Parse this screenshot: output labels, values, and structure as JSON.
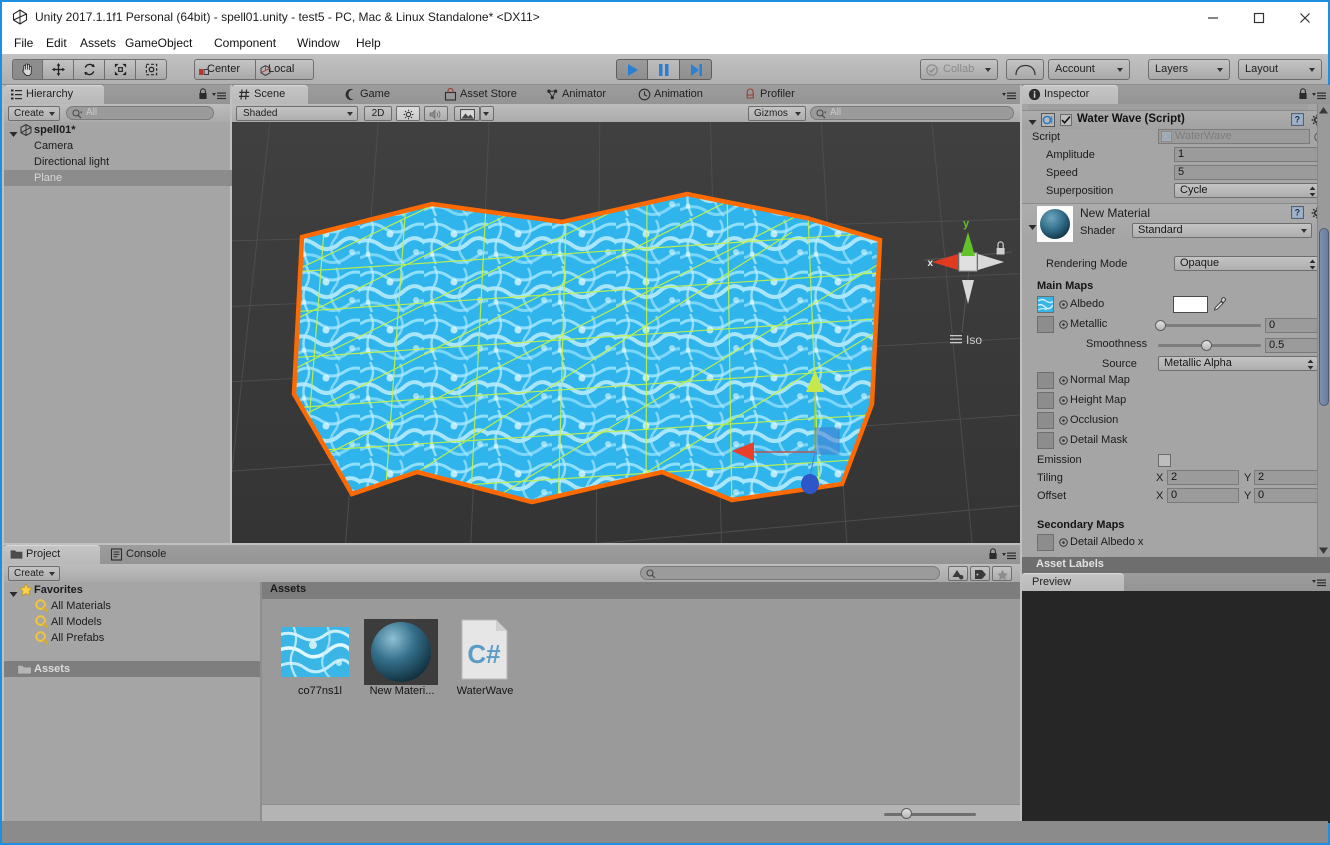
{
  "window": {
    "title": "Unity 2017.1.1f1 Personal (64bit) - spell01.unity - test5 - PC, Mac & Linux Standalone* <DX11>",
    "app_icon": "unity-logo-icon",
    "minimize": "minimize-icon",
    "maximize": "maximize-icon",
    "close": "close-icon"
  },
  "menu": {
    "items": [
      "File",
      "Edit",
      "Assets",
      "GameObject",
      "Component",
      "Window",
      "Help"
    ]
  },
  "toolbar": {
    "transform_tools": [
      {
        "name": "hand-tool",
        "icon": "hand-icon",
        "active": true
      },
      {
        "name": "move-tool",
        "icon": "move-arrows-icon",
        "active": false
      },
      {
        "name": "rotate-tool",
        "icon": "rotate-icon",
        "active": false
      },
      {
        "name": "scale-tool",
        "icon": "scale-icon",
        "active": false
      },
      {
        "name": "rect-tool",
        "icon": "rect-transform-icon",
        "active": false
      }
    ],
    "pivot_mode": "Center",
    "pivot_rotation": "Local",
    "play": "play-icon",
    "pause": "pause-icon",
    "step": "step-icon",
    "collab": "Collab",
    "cloud": "cloud-icon",
    "account": "Account",
    "layers": "Layers",
    "layout": "Layout"
  },
  "hierarchy": {
    "tab": "Hierarchy",
    "tab_icon": "hierarchy-icon",
    "create": "Create",
    "search_placeholder": "All",
    "search_value": "",
    "rows": [
      {
        "label": "spell01*",
        "depth": 0,
        "selected": false,
        "icon": "unity-scene-icon"
      },
      {
        "label": "Camera",
        "depth": 1,
        "selected": false,
        "icon": ""
      },
      {
        "label": "Directional light",
        "depth": 1,
        "selected": false,
        "icon": ""
      },
      {
        "label": "Plane",
        "depth": 1,
        "selected": true,
        "icon": ""
      }
    ]
  },
  "scene": {
    "tabs": [
      {
        "label": "Scene",
        "icon": "scene-icon",
        "selected": true
      },
      {
        "label": "Game",
        "icon": "game-icon",
        "selected": false
      },
      {
        "label": "Asset Store",
        "icon": "asset-store-icon",
        "selected": false
      },
      {
        "label": "Animator",
        "icon": "animator-icon",
        "selected": false
      },
      {
        "label": "Animation",
        "icon": "animation-icon",
        "selected": false
      },
      {
        "label": "Profiler",
        "icon": "profiler-icon",
        "selected": false
      }
    ],
    "draw_mode": "Shaded",
    "toggle_2d": "2D",
    "lighting_icon": "sun-icon",
    "audio_icon": "speaker-icon",
    "fx_icon": "image-icon",
    "gizmos": "Gizmos",
    "search_placeholder": "All",
    "search_value": "",
    "axis_gizmo": {
      "x_label": "x",
      "y_label": "y",
      "projection": "Iso",
      "lock_icon": "lock-icon"
    },
    "object": "water plane mesh with wireframe and orange selection outline"
  },
  "project": {
    "tabs": [
      {
        "label": "Project",
        "icon": "project-folder-icon",
        "selected": true
      },
      {
        "label": "Console",
        "icon": "console-icon",
        "selected": false
      }
    ],
    "create": "Create",
    "search_placeholder": "",
    "search_value": "",
    "filter_type_icon": "filter-type-icon",
    "filter_label_icon": "filter-label-icon",
    "filter_favorite_icon": "star-icon",
    "tree": [
      {
        "label": "Favorites",
        "depth": 0,
        "icon": "star-icon",
        "selected": false,
        "bold": true
      },
      {
        "label": "All Materials",
        "depth": 1,
        "icon": "search-icon",
        "selected": false
      },
      {
        "label": "All Models",
        "depth": 1,
        "icon": "search-icon",
        "selected": false
      },
      {
        "label": "All Prefabs",
        "depth": 1,
        "icon": "search-icon",
        "selected": false
      },
      {
        "label": "Assets",
        "depth": 0,
        "icon": "folder-icon",
        "selected": true,
        "bold": true
      }
    ],
    "breadcrumb": "Assets",
    "assets": [
      {
        "label": "co77ns1l",
        "kind": "texture"
      },
      {
        "label": "New Materi...",
        "kind": "material"
      },
      {
        "label": "WaterWave",
        "kind": "script",
        "glyph": "C#"
      }
    ],
    "zoom_value": 35
  },
  "inspector": {
    "tab": "Inspector",
    "tab_icon": "info-icon",
    "lock_icon": "lock-icon",
    "menu_icon": "panel-menu-icon",
    "script_component": {
      "title": "Water Wave (Script)",
      "enabled": true,
      "icon": "cs-script-icon",
      "help_icon": "help-icon",
      "settings_icon": "gear-icon",
      "fields": [
        {
          "label": "Script",
          "value": "WaterWave",
          "type": "object",
          "readonly": true
        },
        {
          "label": "Amplitude",
          "value": "1",
          "type": "number"
        },
        {
          "label": "Speed",
          "value": "5",
          "type": "number"
        },
        {
          "label": "Superposition",
          "value": "Cycle",
          "type": "enum"
        }
      ]
    },
    "material": {
      "name": "New Material",
      "preview_icon": "material-sphere-icon",
      "help_icon": "help-icon",
      "settings_icon": "gear-icon",
      "shader_label": "Shader",
      "shader_value": "Standard",
      "rendering_mode_label": "Rendering Mode",
      "rendering_mode_value": "Opaque",
      "main_maps_header": "Main Maps",
      "maps": [
        {
          "label": "Albedo",
          "has_texture": true,
          "swatch": "#ffffff",
          "eyedropper": true
        },
        {
          "label": "Metallic",
          "has_texture": false,
          "slider": 0,
          "slider_value": "0"
        },
        {
          "label": "Smoothness",
          "indent": true,
          "slider": 0.5,
          "slider_value": "0.5"
        },
        {
          "label": "Source",
          "indent": true,
          "enum_value": "Metallic Alpha"
        },
        {
          "label": "Normal Map",
          "has_texture": false
        },
        {
          "label": "Height Map",
          "has_texture": false
        },
        {
          "label": "Occlusion",
          "has_texture": false
        },
        {
          "label": "Detail Mask",
          "has_texture": false
        }
      ],
      "emission_label": "Emission",
      "emission_checked": false,
      "tiling_label": "Tiling",
      "tiling_x_label": "X",
      "tiling_x": "2",
      "tiling_y_label": "Y",
      "tiling_y": "2",
      "offset_label": "Offset",
      "offset_x_label": "X",
      "offset_x": "0",
      "offset_y_label": "Y",
      "offset_y": "0",
      "secondary_maps_header": "Secondary Maps",
      "secondary_first": "Detail Albedo x"
    },
    "asset_labels": "Asset Labels",
    "preview_tab": "Preview"
  }
}
